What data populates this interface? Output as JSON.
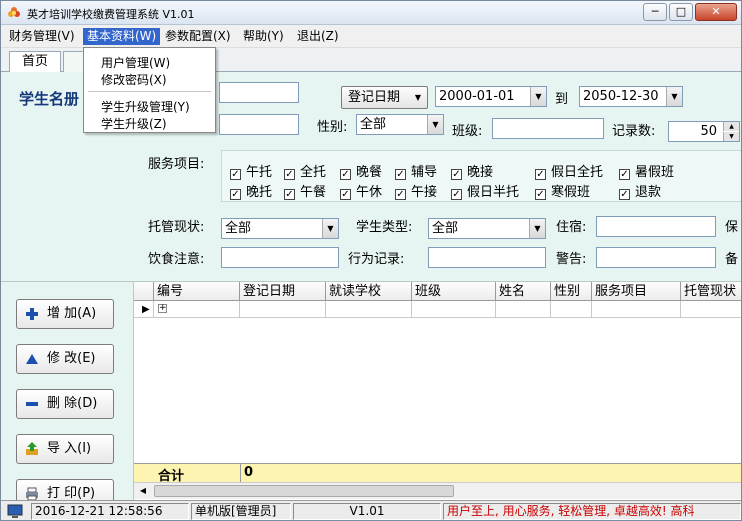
{
  "window": {
    "title": "英才培训学校缴费管理系统 V1.01",
    "controls": {
      "minimize": "─",
      "maximize": "□",
      "close": "✕"
    }
  },
  "menu": {
    "items": [
      {
        "label": "财务管理(V)"
      },
      {
        "label": "基本资料(W)"
      },
      {
        "label": "参数配置(X)"
      },
      {
        "label": "帮助(Y)"
      },
      {
        "label": "退出(Z)"
      }
    ],
    "dropdown": [
      "用户管理(W)",
      "修改密码(X)",
      "学生升级管理(Y)",
      "学生升级(Z)"
    ]
  },
  "tabs": [
    {
      "label": "首页"
    }
  ],
  "form": {
    "heading": "学生名册",
    "register_date_label": "登记日期",
    "date_from": "2000-01-01",
    "to_label": "到",
    "date_to": "2050-12-30",
    "gender_label": "性别:",
    "gender_value": "全部",
    "class_label": "班级:",
    "record_count_label": "记录数:",
    "record_count_value": "50",
    "service_label": "服务项目:",
    "services_row1": [
      "午托",
      "全托",
      "晚餐",
      "辅导",
      "晚接",
      "假日全托",
      "暑假班"
    ],
    "services_row2": [
      "晚托",
      "午餐",
      "午休",
      "午接",
      "假日半托",
      "寒假班",
      "退款"
    ],
    "custody_label": "托管现状:",
    "custody_value": "全部",
    "student_type_label": "学生类型:",
    "student_type_value": "全部",
    "lodging_label": "住宿:",
    "bao_label": "保",
    "diet_label": "饮食注意:",
    "behavior_label": "行为记录:",
    "warning_label": "警告:",
    "bei_label": "备"
  },
  "actions": {
    "add": "增 加(A)",
    "edit": "修 改(E)",
    "delete": "删 除(D)",
    "import": "导 入(I)",
    "print": "打 印(P)"
  },
  "grid": {
    "columns": [
      "编号",
      "登记日期",
      "就读学校",
      "班级",
      "姓名",
      "性别",
      "服务项目",
      "托管现状"
    ],
    "total_label": "合计",
    "total_value": "0",
    "row_marker": "▶",
    "expand": "+"
  },
  "status": {
    "datetime": "2016-12-21 12:58:56",
    "mode": "单机版[管理员]",
    "version": "V1.01",
    "slogan": "用户至上, 用心服务, 轻松管理, 卓越高效! 高科"
  },
  "colors": {
    "panel_bg": "#e6f5f2",
    "menu_highlight": "#3366cc",
    "status_slogan": "#cc0000",
    "footer_bg": "#fcf4b0"
  }
}
